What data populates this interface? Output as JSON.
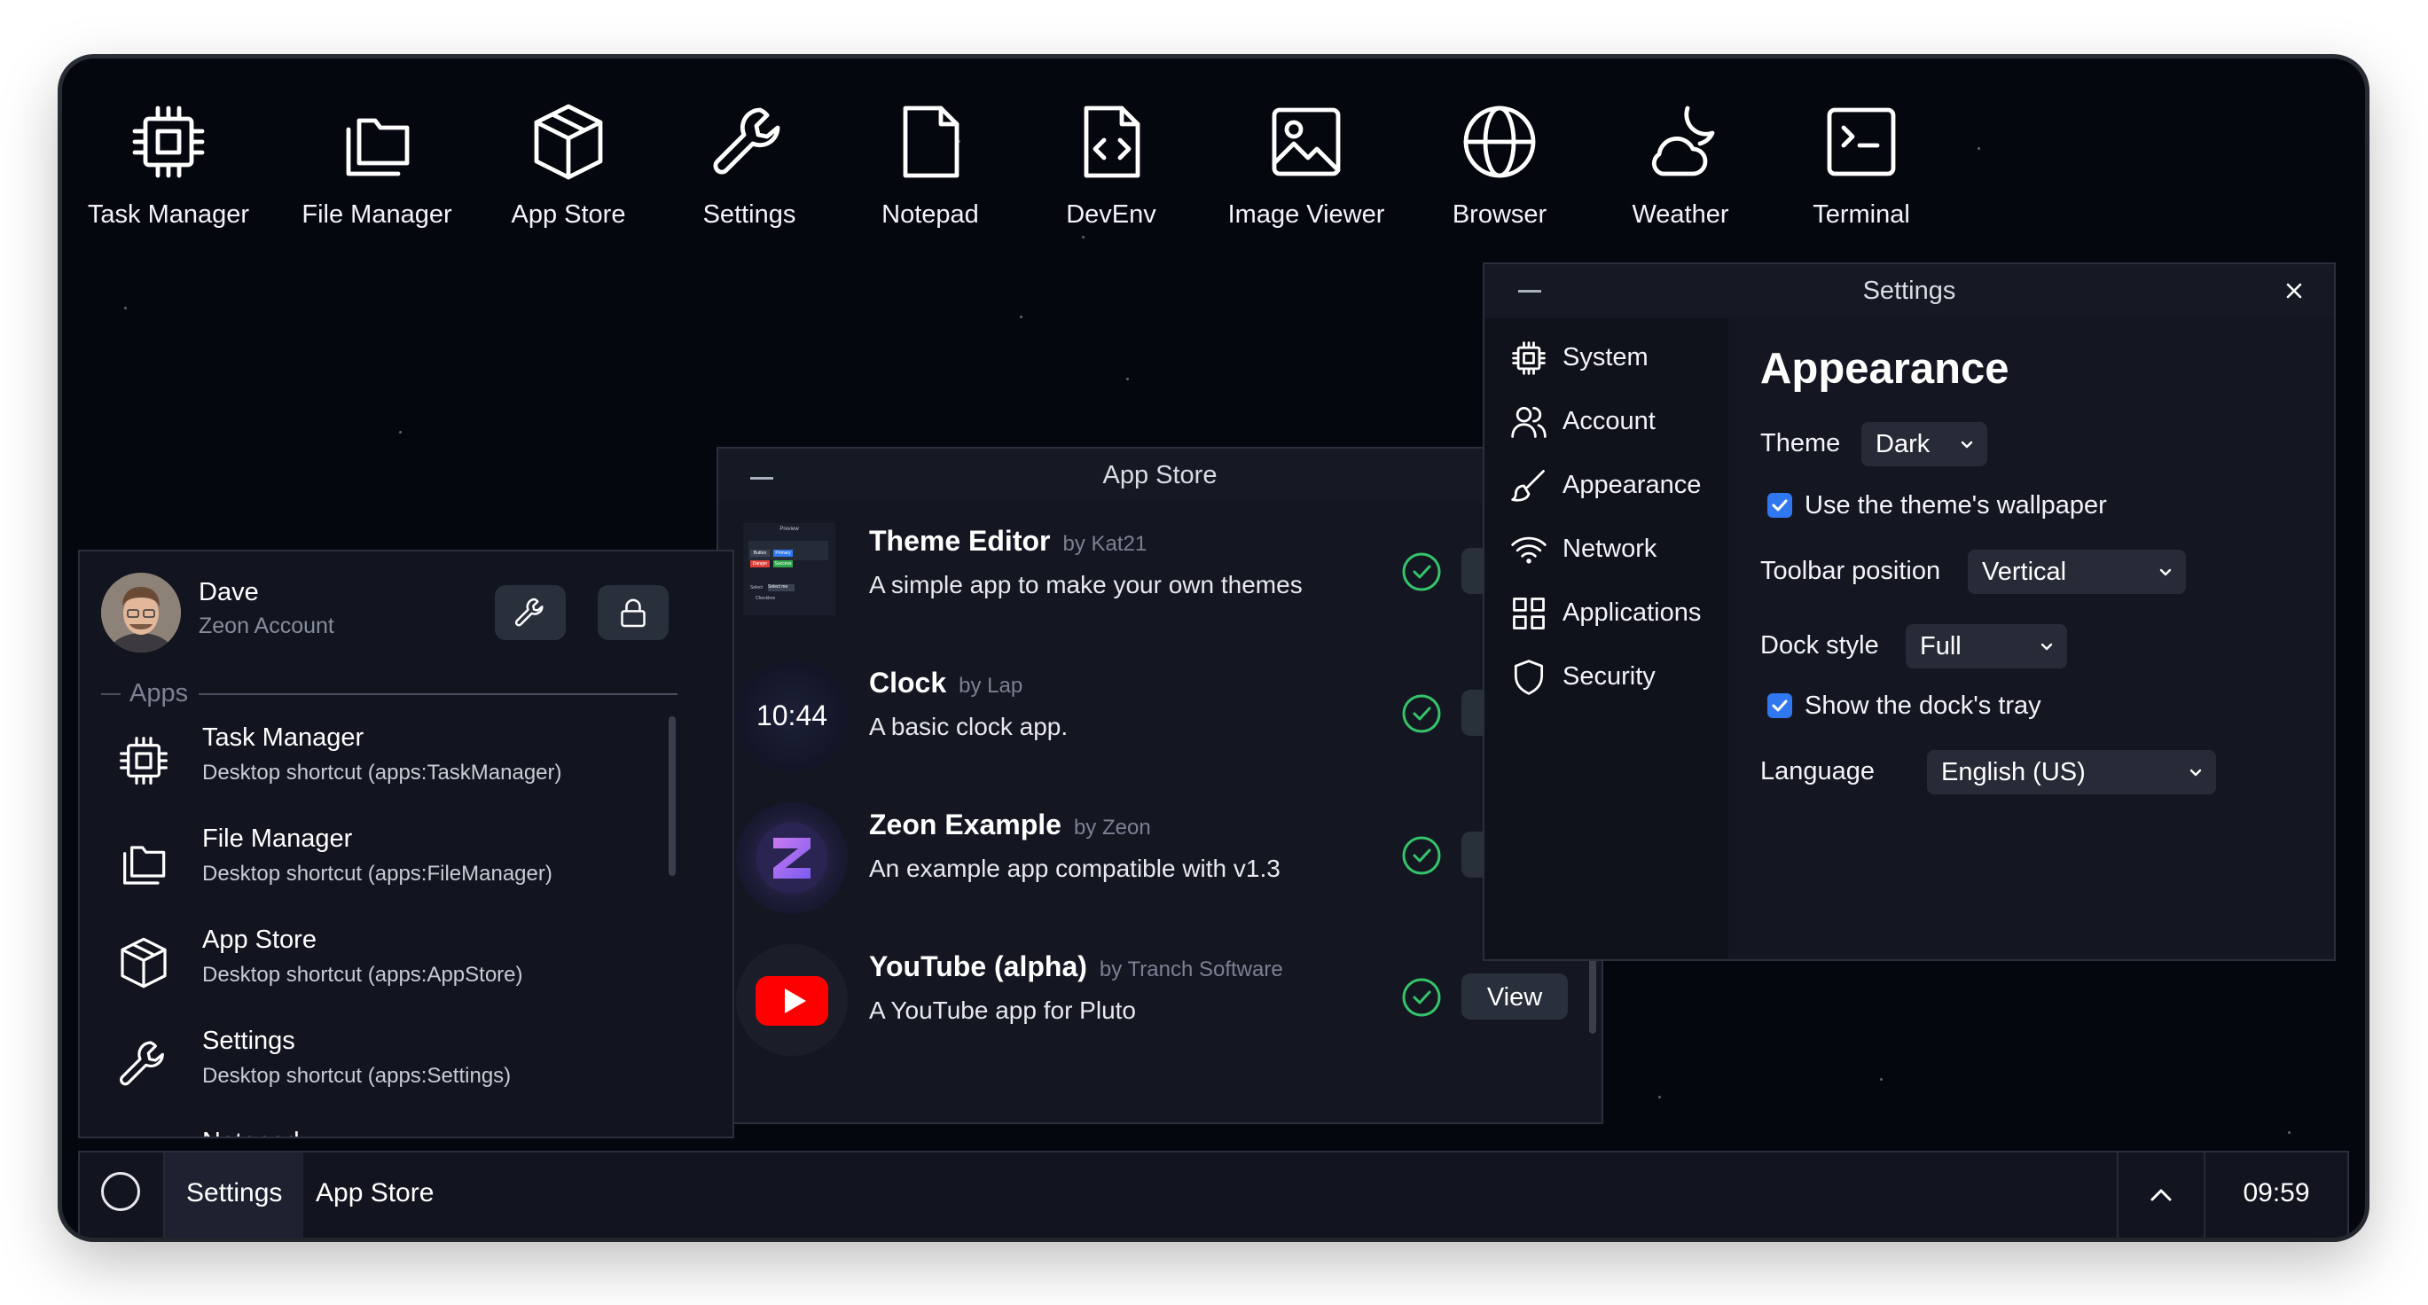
{
  "desktop": {
    "icons": [
      {
        "label": "Task Manager",
        "icon": "cpu-icon"
      },
      {
        "label": "File Manager",
        "icon": "folders-icon"
      },
      {
        "label": "App Store",
        "icon": "box-icon"
      },
      {
        "label": "Settings",
        "icon": "wrench-icon"
      },
      {
        "label": "Notepad",
        "icon": "file-icon"
      },
      {
        "label": "DevEnv",
        "icon": "code-file-icon"
      },
      {
        "label": "Image Viewer",
        "icon": "image-icon"
      },
      {
        "label": "Browser",
        "icon": "globe-icon"
      },
      {
        "label": "Weather",
        "icon": "cloud-moon-icon"
      },
      {
        "label": "Terminal",
        "icon": "terminal-icon"
      }
    ]
  },
  "appstore": {
    "title": "App Store",
    "apps": [
      {
        "name": "Theme Editor",
        "author": "by Kat21",
        "desc": "A simple app to make your own themes",
        "action": "View"
      },
      {
        "name": "Clock",
        "author": "by Lap",
        "desc": "A basic clock app.",
        "thumb_text": "10:44",
        "action": "View"
      },
      {
        "name": "Zeon Example",
        "author": "by Zeon",
        "desc": "An example app compatible with v1.3",
        "action": "View"
      },
      {
        "name": "YouTube (alpha)",
        "author": "by Tranch Software",
        "desc": "A YouTube app for Pluto",
        "action": "View"
      }
    ],
    "theme_preview": {
      "title": "Preview",
      "buttons": [
        "Button",
        "Primary",
        "Danger",
        "Success"
      ],
      "select": "Select",
      "select_value": "Select me",
      "checkbox": "Checkbox"
    }
  },
  "settings": {
    "title": "Settings",
    "sidebar": [
      {
        "label": "System",
        "icon": "cpu-icon"
      },
      {
        "label": "Account",
        "icon": "users-icon"
      },
      {
        "label": "Appearance",
        "icon": "brush-icon"
      },
      {
        "label": "Network",
        "icon": "wifi-icon"
      },
      {
        "label": "Applications",
        "icon": "grid-icon"
      },
      {
        "label": "Security",
        "icon": "shield-icon"
      }
    ],
    "heading": "Appearance",
    "theme_label": "Theme",
    "theme_value": "Dark",
    "wallpaper_label": "Use the theme's wallpaper",
    "wallpaper_checked": true,
    "toolbar_label": "Toolbar position",
    "toolbar_value": "Vertical",
    "dock_label": "Dock style",
    "dock_value": "Full",
    "tray_label": "Show the dock's tray",
    "tray_checked": true,
    "language_label": "Language",
    "language_value": "English (US)"
  },
  "launcher": {
    "user_name": "Dave",
    "user_sub": "Zeon Account",
    "section": "Apps",
    "items": [
      {
        "name": "Task Manager",
        "desc": "Desktop shortcut (apps:TaskManager)",
        "icon": "cpu-icon"
      },
      {
        "name": "File Manager",
        "desc": "Desktop shortcut (apps:FileManager)",
        "icon": "folders-icon"
      },
      {
        "name": "App Store",
        "desc": "Desktop shortcut (apps:AppStore)",
        "icon": "box-icon"
      },
      {
        "name": "Settings",
        "desc": "Desktop shortcut (apps:Settings)",
        "icon": "wrench-icon"
      },
      {
        "name": "Notepad",
        "desc": "",
        "icon": "file-icon"
      }
    ]
  },
  "dock": {
    "tasks": [
      "Settings",
      "App Store"
    ],
    "clock": "09:59"
  },
  "colors": {
    "accent": "#2f78f0",
    "check_green": "#35c46a",
    "background": "#05070f"
  }
}
